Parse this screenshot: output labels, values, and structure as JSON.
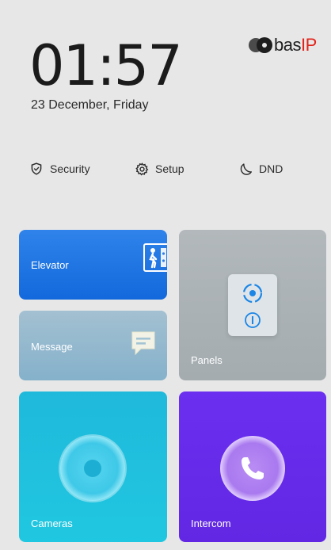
{
  "status": {
    "time": "01:57",
    "date": "23 December, Friday"
  },
  "brand": {
    "logo_text_main": "bas",
    "logo_text_accent": "IP",
    "accent_color": "#e2231a"
  },
  "quick_actions": [
    {
      "label": "Security",
      "icon": "shield-icon"
    },
    {
      "label": "Setup",
      "icon": "gear-icon"
    },
    {
      "label": "DND",
      "icon": "moon-icon"
    }
  ],
  "tiles": {
    "elevator": {
      "label": "Elevator",
      "icon": "elevator-icon",
      "color": "#1f74e4"
    },
    "message": {
      "label": "Message",
      "icon": "message-icon",
      "color": "#94b8ce"
    },
    "panels": {
      "label": "Panels",
      "icon": "panel-device-icon",
      "color": "#aab1b4"
    },
    "cameras": {
      "label": "Cameras",
      "icon": "camera-icon",
      "color": "#20c0de"
    },
    "intercom": {
      "label": "Intercom",
      "icon": "phone-icon",
      "color": "#652be8"
    }
  }
}
